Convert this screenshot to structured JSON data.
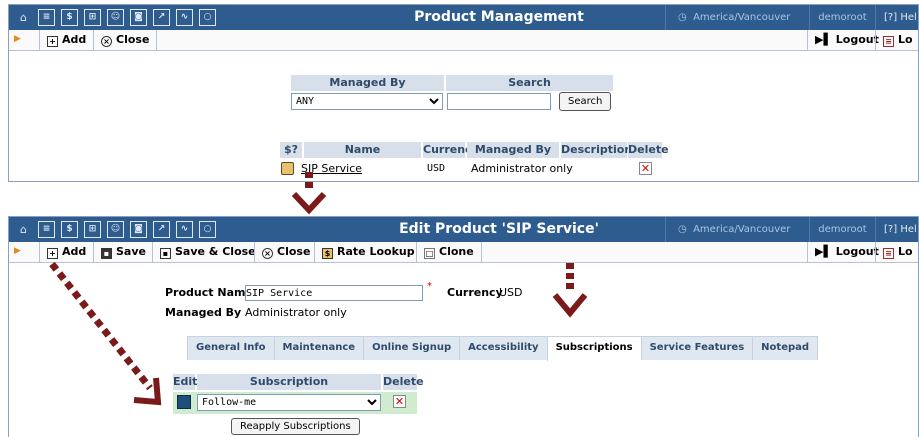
{
  "nav_icons": [
    "home-icon",
    "list-icon",
    "dollar-icon",
    "grid-icon",
    "person-icon",
    "customers-icon",
    "exit-icon",
    "chart-icon",
    "search-icon"
  ],
  "timezone": "America/Vancouver",
  "user": "demoroot",
  "help_label": "Hel",
  "logout_label": "Logout",
  "logout2_label": "Lo",
  "top": {
    "title": "Product Management",
    "toolbar": {
      "add": "Add",
      "close": "Close"
    },
    "search": {
      "managed_by_label": "Managed By",
      "search_label": "Search",
      "managed_by_value": "ANY",
      "search_value": "",
      "search_button": "Search"
    },
    "table": {
      "headers": [
        "$?",
        "Name",
        "Currency",
        "Managed By",
        "Description",
        "Delete"
      ],
      "rows": [
        {
          "name": "SIP Service",
          "currency": "USD",
          "managed_by": "Administrator only",
          "description": ""
        }
      ]
    }
  },
  "bottom": {
    "title": "Edit Product 'SIP Service'",
    "toolbar": {
      "add": "Add",
      "save": "Save",
      "save_close": "Save & Close",
      "close": "Close",
      "rate_lookup": "Rate Lookup",
      "clone": "Clone"
    },
    "form": {
      "product_name_label": "Product Name",
      "product_name_value": "SIP Service",
      "required_mark": "*",
      "currency_label": "Currency",
      "currency_value": "USD",
      "managed_by_label": "Managed By",
      "managed_by_value": "Administrator only"
    },
    "tabs": [
      "General Info",
      "Maintenance",
      "Online Signup",
      "Accessibility",
      "Subscriptions",
      "Service Features",
      "Notepad"
    ],
    "active_tab": "Subscriptions",
    "subs": {
      "headers": [
        "Edit",
        "Subscription",
        "Delete"
      ],
      "row_value": "Follow-me",
      "reapply_button": "Reapply Subscriptions"
    }
  },
  "colors": {
    "titlebar": "#2f5c8f",
    "header_cell": "#d7e0ea",
    "arrow": "#7a1a1a",
    "delete_x": "#dd0000"
  }
}
